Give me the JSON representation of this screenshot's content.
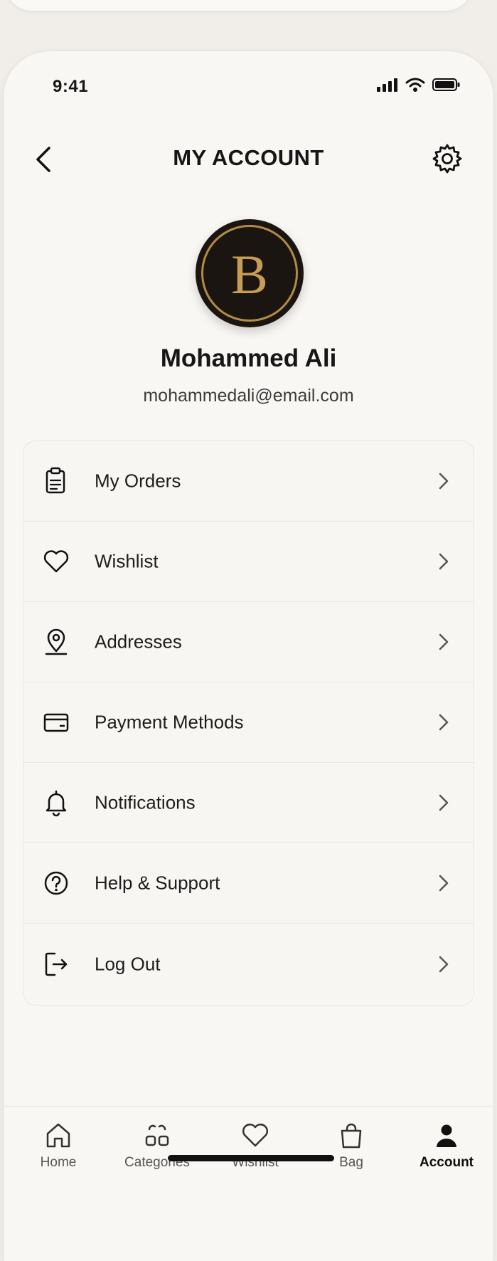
{
  "status_bar": {
    "time": "9:41"
  },
  "header": {
    "title": "MY ACCOUNT"
  },
  "profile": {
    "avatar_letter": "B",
    "name": "Mohammed Ali",
    "email": "mohammedali@email.com"
  },
  "menu": {
    "items": [
      {
        "label": "My Orders",
        "icon": "orders-icon"
      },
      {
        "label": "Wishlist",
        "icon": "heart-icon"
      },
      {
        "label": "Addresses",
        "icon": "location-pin-icon"
      },
      {
        "label": "Payment Methods",
        "icon": "credit-card-icon"
      },
      {
        "label": "Notifications",
        "icon": "bell-icon"
      },
      {
        "label": "Help & Support",
        "icon": "help-circle-icon"
      },
      {
        "label": "Log Out",
        "icon": "logout-icon"
      }
    ]
  },
  "bottom_nav": {
    "items": [
      {
        "label": "Home",
        "icon": "home-icon"
      },
      {
        "label": "Categories",
        "icon": "categories-icon"
      },
      {
        "label": "Wishlist",
        "icon": "heart-icon"
      },
      {
        "label": "Bag",
        "icon": "bag-icon"
      },
      {
        "label": "Account",
        "icon": "user-icon",
        "active": true
      }
    ]
  },
  "colors": {
    "background": "#f9f7f4",
    "avatar_bg": "#1a1510",
    "avatar_gold": "#c79c55",
    "text": "#161616"
  }
}
